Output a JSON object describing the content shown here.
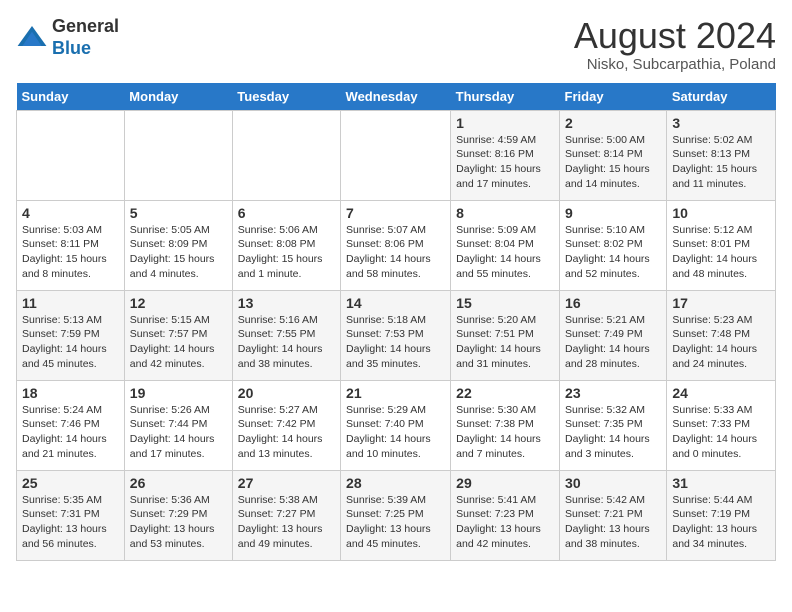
{
  "header": {
    "logo_general": "General",
    "logo_blue": "Blue",
    "month_title": "August 2024",
    "location": "Nisko, Subcarpathia, Poland"
  },
  "weekdays": [
    "Sunday",
    "Monday",
    "Tuesday",
    "Wednesday",
    "Thursday",
    "Friday",
    "Saturday"
  ],
  "weeks": [
    [
      {
        "day": "",
        "sunrise": "",
        "sunset": "",
        "daylight": ""
      },
      {
        "day": "",
        "sunrise": "",
        "sunset": "",
        "daylight": ""
      },
      {
        "day": "",
        "sunrise": "",
        "sunset": "",
        "daylight": ""
      },
      {
        "day": "",
        "sunrise": "",
        "sunset": "",
        "daylight": ""
      },
      {
        "day": "1",
        "sunrise": "Sunrise: 4:59 AM",
        "sunset": "Sunset: 8:16 PM",
        "daylight": "Daylight: 15 hours and 17 minutes."
      },
      {
        "day": "2",
        "sunrise": "Sunrise: 5:00 AM",
        "sunset": "Sunset: 8:14 PM",
        "daylight": "Daylight: 15 hours and 14 minutes."
      },
      {
        "day": "3",
        "sunrise": "Sunrise: 5:02 AM",
        "sunset": "Sunset: 8:13 PM",
        "daylight": "Daylight: 15 hours and 11 minutes."
      }
    ],
    [
      {
        "day": "4",
        "sunrise": "Sunrise: 5:03 AM",
        "sunset": "Sunset: 8:11 PM",
        "daylight": "Daylight: 15 hours and 8 minutes."
      },
      {
        "day": "5",
        "sunrise": "Sunrise: 5:05 AM",
        "sunset": "Sunset: 8:09 PM",
        "daylight": "Daylight: 15 hours and 4 minutes."
      },
      {
        "day": "6",
        "sunrise": "Sunrise: 5:06 AM",
        "sunset": "Sunset: 8:08 PM",
        "daylight": "Daylight: 15 hours and 1 minute."
      },
      {
        "day": "7",
        "sunrise": "Sunrise: 5:07 AM",
        "sunset": "Sunset: 8:06 PM",
        "daylight": "Daylight: 14 hours and 58 minutes."
      },
      {
        "day": "8",
        "sunrise": "Sunrise: 5:09 AM",
        "sunset": "Sunset: 8:04 PM",
        "daylight": "Daylight: 14 hours and 55 minutes."
      },
      {
        "day": "9",
        "sunrise": "Sunrise: 5:10 AM",
        "sunset": "Sunset: 8:02 PM",
        "daylight": "Daylight: 14 hours and 52 minutes."
      },
      {
        "day": "10",
        "sunrise": "Sunrise: 5:12 AM",
        "sunset": "Sunset: 8:01 PM",
        "daylight": "Daylight: 14 hours and 48 minutes."
      }
    ],
    [
      {
        "day": "11",
        "sunrise": "Sunrise: 5:13 AM",
        "sunset": "Sunset: 7:59 PM",
        "daylight": "Daylight: 14 hours and 45 minutes."
      },
      {
        "day": "12",
        "sunrise": "Sunrise: 5:15 AM",
        "sunset": "Sunset: 7:57 PM",
        "daylight": "Daylight: 14 hours and 42 minutes."
      },
      {
        "day": "13",
        "sunrise": "Sunrise: 5:16 AM",
        "sunset": "Sunset: 7:55 PM",
        "daylight": "Daylight: 14 hours and 38 minutes."
      },
      {
        "day": "14",
        "sunrise": "Sunrise: 5:18 AM",
        "sunset": "Sunset: 7:53 PM",
        "daylight": "Daylight: 14 hours and 35 minutes."
      },
      {
        "day": "15",
        "sunrise": "Sunrise: 5:20 AM",
        "sunset": "Sunset: 7:51 PM",
        "daylight": "Daylight: 14 hours and 31 minutes."
      },
      {
        "day": "16",
        "sunrise": "Sunrise: 5:21 AM",
        "sunset": "Sunset: 7:49 PM",
        "daylight": "Daylight: 14 hours and 28 minutes."
      },
      {
        "day": "17",
        "sunrise": "Sunrise: 5:23 AM",
        "sunset": "Sunset: 7:48 PM",
        "daylight": "Daylight: 14 hours and 24 minutes."
      }
    ],
    [
      {
        "day": "18",
        "sunrise": "Sunrise: 5:24 AM",
        "sunset": "Sunset: 7:46 PM",
        "daylight": "Daylight: 14 hours and 21 minutes."
      },
      {
        "day": "19",
        "sunrise": "Sunrise: 5:26 AM",
        "sunset": "Sunset: 7:44 PM",
        "daylight": "Daylight: 14 hours and 17 minutes."
      },
      {
        "day": "20",
        "sunrise": "Sunrise: 5:27 AM",
        "sunset": "Sunset: 7:42 PM",
        "daylight": "Daylight: 14 hours and 13 minutes."
      },
      {
        "day": "21",
        "sunrise": "Sunrise: 5:29 AM",
        "sunset": "Sunset: 7:40 PM",
        "daylight": "Daylight: 14 hours and 10 minutes."
      },
      {
        "day": "22",
        "sunrise": "Sunrise: 5:30 AM",
        "sunset": "Sunset: 7:38 PM",
        "daylight": "Daylight: 14 hours and 7 minutes."
      },
      {
        "day": "23",
        "sunrise": "Sunrise: 5:32 AM",
        "sunset": "Sunset: 7:35 PM",
        "daylight": "Daylight: 14 hours and 3 minutes."
      },
      {
        "day": "24",
        "sunrise": "Sunrise: 5:33 AM",
        "sunset": "Sunset: 7:33 PM",
        "daylight": "Daylight: 14 hours and 0 minutes."
      }
    ],
    [
      {
        "day": "25",
        "sunrise": "Sunrise: 5:35 AM",
        "sunset": "Sunset: 7:31 PM",
        "daylight": "Daylight: 13 hours and 56 minutes."
      },
      {
        "day": "26",
        "sunrise": "Sunrise: 5:36 AM",
        "sunset": "Sunset: 7:29 PM",
        "daylight": "Daylight: 13 hours and 53 minutes."
      },
      {
        "day": "27",
        "sunrise": "Sunrise: 5:38 AM",
        "sunset": "Sunset: 7:27 PM",
        "daylight": "Daylight: 13 hours and 49 minutes."
      },
      {
        "day": "28",
        "sunrise": "Sunrise: 5:39 AM",
        "sunset": "Sunset: 7:25 PM",
        "daylight": "Daylight: 13 hours and 45 minutes."
      },
      {
        "day": "29",
        "sunrise": "Sunrise: 5:41 AM",
        "sunset": "Sunset: 7:23 PM",
        "daylight": "Daylight: 13 hours and 42 minutes."
      },
      {
        "day": "30",
        "sunrise": "Sunrise: 5:42 AM",
        "sunset": "Sunset: 7:21 PM",
        "daylight": "Daylight: 13 hours and 38 minutes."
      },
      {
        "day": "31",
        "sunrise": "Sunrise: 5:44 AM",
        "sunset": "Sunset: 7:19 PM",
        "daylight": "Daylight: 13 hours and 34 minutes."
      }
    ]
  ]
}
